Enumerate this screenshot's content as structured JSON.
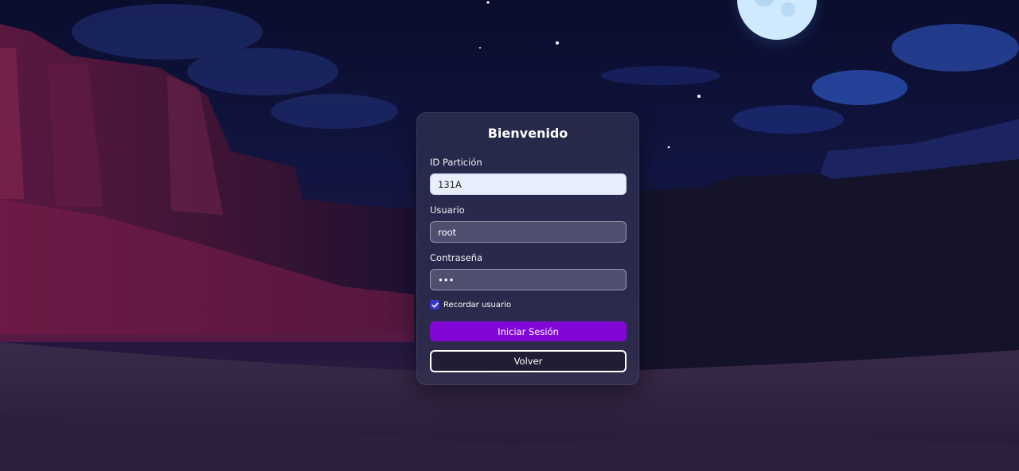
{
  "login": {
    "title": "Bienvenido",
    "partition_label": "ID Partición",
    "partition_value": "131A",
    "user_label": "Usuario",
    "user_value": "root",
    "password_label": "Contraseña",
    "password_value": "abc",
    "remember_label": "Recordar usuario",
    "remember_checked": true,
    "submit_label": "Iniciar Sesión",
    "back_label": "Volver"
  },
  "colors": {
    "primary_button": "#8207d6",
    "checkbox": "#3b36c9",
    "active_input": "#e8eefc"
  },
  "icons": {
    "checkbox_mark": "check-icon"
  }
}
